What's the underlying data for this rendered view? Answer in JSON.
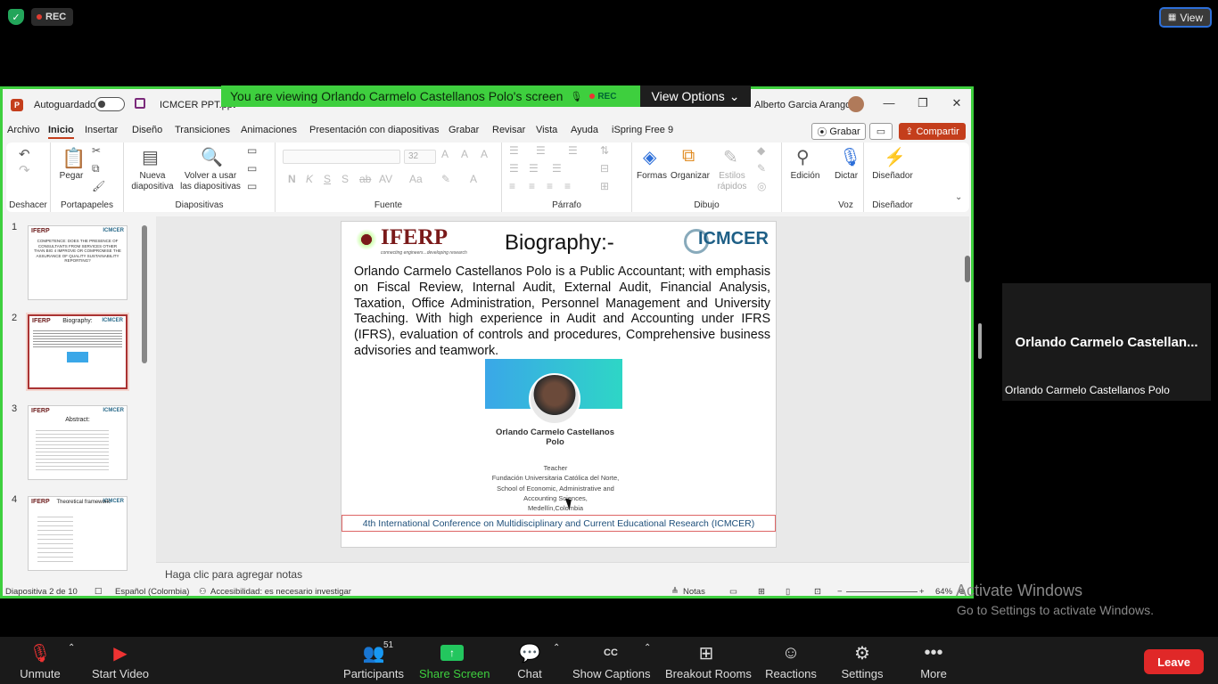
{
  "zoom": {
    "rec_label": "REC",
    "view_label": "View",
    "banner_text": "You are viewing Orlando Carmelo Castellanos Polo's screen",
    "banner_rec": "REC",
    "view_options": "View Options",
    "participant_tile_name": "Orlando Carmelo Castellan...",
    "participant_full_name": "Orlando Carmelo Castellanos Polo",
    "toolbar": {
      "unmute": "Unmute",
      "start_video": "Start Video",
      "participants": "Participants",
      "participants_count": "51",
      "share_screen": "Share Screen",
      "chat": "Chat",
      "captions": "Show Captions",
      "breakout": "Breakout Rooms",
      "reactions": "Reactions",
      "settings": "Settings",
      "more": "More",
      "leave": "Leave"
    },
    "watermark_line1": "Activate Windows",
    "watermark_line2": "Go to Settings to activate Windows."
  },
  "ppt": {
    "autosave": "Autoguardado",
    "filename": "ICMCER PPT.ppt",
    "user": "Alberto Garcia Arango",
    "menu": [
      "Archivo",
      "Inicio",
      "Insertar",
      "Diseño",
      "Transiciones",
      "Animaciones",
      "Presentación con diapositivas",
      "Grabar",
      "Revisar",
      "Vista",
      "Ayuda",
      "iSpring Free 9"
    ],
    "grabar": "Grabar",
    "compartir": "Compartir",
    "ribbon": {
      "deshacer": "Deshacer",
      "portapapeles": "Portapapeles",
      "pegar": "Pegar",
      "nueva": "Nueva",
      "diapositiva": "diapositiva",
      "volver": "Volver a usar",
      "las_diapositivas": "las diapositivas",
      "diapositivas": "Diapositivas",
      "font_size": "32",
      "fuente": "Fuente",
      "parrafo": "Párrafo",
      "formas": "Formas",
      "organizar": "Organizar",
      "estilos": "Estilos",
      "rapidos": "rápidos",
      "dibujo": "Dibujo",
      "edicion": "Edición",
      "dictar": "Dictar",
      "voz": "Voz",
      "disenador": "Diseñador",
      "disenador_group": "Diseñador"
    },
    "thumbnails": [
      {
        "num": "1",
        "text": "COMPETENCE: DOES THE PRESENCE OF CONSULTANTS FROM SERVICES OTHER THAN BIG 4 IMPROVE OR COMPROMISE THE ASSURANCE OF QUALITY SUSTAINABILITY REPORTING?"
      },
      {
        "num": "2",
        "title": "Biography:"
      },
      {
        "num": "3",
        "title": "Abstract:"
      },
      {
        "num": "4",
        "title": "Theoretical framework:"
      }
    ],
    "slide": {
      "logo_left": "IFERP",
      "logo_left_sub": "connecting engineers...developing research",
      "title": "Biography:-",
      "logo_right": "ICMCER",
      "bio": "Orlando Carmelo Castellanos Polo is a Public Accountant; with emphasis on Fiscal Review, Internal Audit, External Audit, Financial Analysis, Taxation, Office Administration, Personnel Management and University Teaching. With high experience in Audit and Accounting under IFRS (IFRS), evaluation of controls and procedures, Comprehensive business advisories and teamwork.",
      "person_name": "Orlando Carmelo Castellanos Polo",
      "info_lines": [
        "Teacher",
        "Fundación Universitaria Católica del Norte,",
        "School of Economic, Administrative and",
        "Accounting Sciences,",
        "Medellín,Colombia"
      ],
      "footer": "4th International Conference on Multidisciplinary and Current Educational Research (ICMCER)"
    },
    "notes_placeholder": "Haga clic para agregar notas",
    "status": {
      "slide_of": "Diapositiva 2 de 10",
      "language": "Español (Colombia)",
      "accessibility": "Accesibilidad: es necesario investigar",
      "notes": "Notas",
      "zoom": "64%"
    }
  },
  "colors": {
    "share_border": "#3ecf3e",
    "ppt_accent": "#c43e1c",
    "leave": "#e02828"
  }
}
